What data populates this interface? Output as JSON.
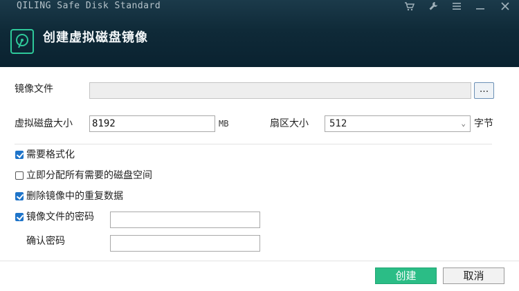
{
  "window": {
    "app_title": "QILING Safe Disk Standard",
    "dialog_title": "创建虚拟磁盘镜像"
  },
  "form": {
    "image_file_label": "镜像文件",
    "image_file_value": "",
    "browse_label": "...",
    "disk_size_label": "虚拟磁盘大小",
    "disk_size_value": "8192",
    "disk_size_unit": "MB",
    "sector_size_label": "扇区大小",
    "sector_size_value": "512",
    "sector_size_unit": "字节"
  },
  "options": {
    "format_label": "需要格式化",
    "format_checked": true,
    "allocate_label": "立即分配所有需要的磁盘空间",
    "allocate_checked": false,
    "dedupe_label": "删除镜像中的重复数据",
    "dedupe_checked": true,
    "password_label": "镜像文件的密码",
    "password_checked": true,
    "password_value": "",
    "confirm_label": "确认密码",
    "confirm_value": ""
  },
  "buttons": {
    "create_label": "创建",
    "cancel_label": "取消"
  },
  "colors": {
    "accent": "#2bbd86",
    "checkbox": "#1e74c9",
    "header": "#0f2a38"
  },
  "icons": {
    "cart": "cart-icon",
    "settings": "wrench-icon",
    "menu": "menu-icon",
    "minimize": "minimize-icon",
    "close": "close-icon",
    "disk": "disk-icon"
  }
}
